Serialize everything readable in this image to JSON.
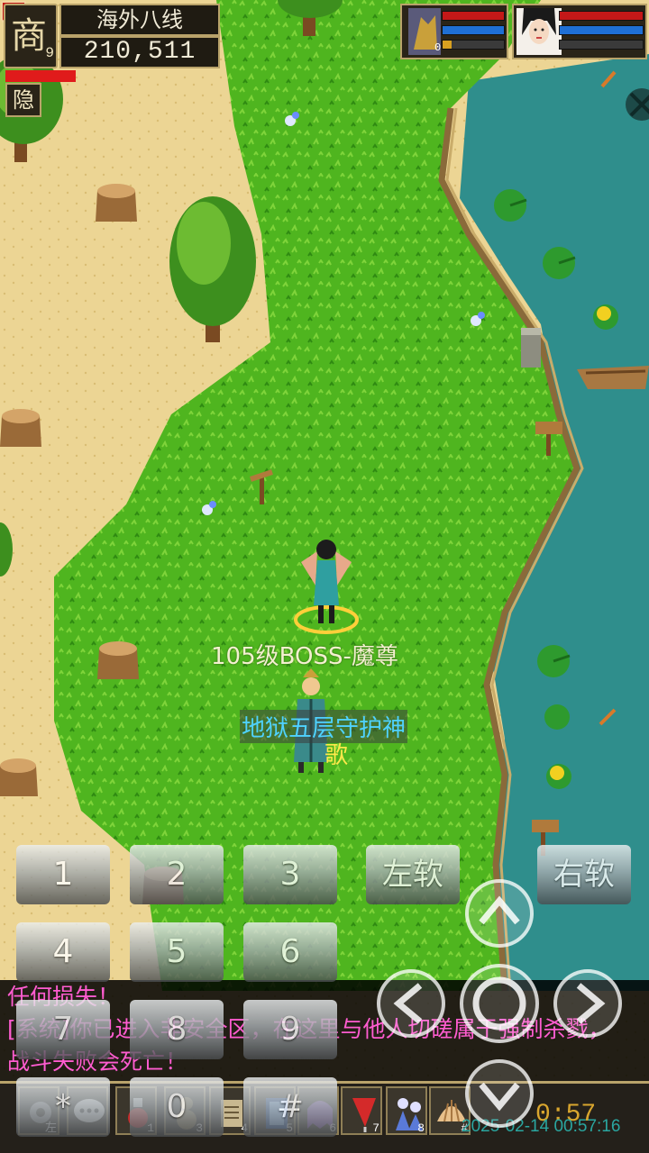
{
  "hud": {
    "avatar_glyph": "商",
    "level": "9",
    "server": "海外八线",
    "money": "210,511",
    "hide_label": "隐",
    "hp_fraction": 0.64,
    "pet": {
      "level": "0",
      "hp": 1.0,
      "mp": 1.0,
      "xp": 0.15
    },
    "player": {
      "hp": 1.0,
      "mp": 1.0,
      "xp": 0.0
    }
  },
  "characters": {
    "boss_name": "105级BOSS-魔尊",
    "npc_title": "地狱五层守护神",
    "npc_name": "歌"
  },
  "keypad": {
    "keys": [
      "1",
      "2",
      "3",
      "4",
      "5",
      "6",
      "7",
      "8",
      "9",
      "*",
      "0",
      "#"
    ],
    "left_soft": "左软",
    "right_soft": "右软"
  },
  "chat": {
    "lines": [
      "任何损失！",
      "[系统]你已进入非安全区，在这里与他人切磋属于强制杀戮，",
      "战斗失败会死亡！"
    ]
  },
  "skillbar": {
    "slots": [
      {
        "icon": "gear-icon",
        "num": "左"
      },
      {
        "icon": "chat-icon",
        "num": ""
      },
      {
        "icon": "potion-icon",
        "num": "1"
      },
      {
        "icon": "gourd-icon",
        "num": "3"
      },
      {
        "icon": "scroll-icon",
        "num": "4"
      },
      {
        "icon": "card-icon",
        "num": "5"
      },
      {
        "icon": "ghost-icon",
        "num": "6"
      },
      {
        "icon": "flag-icon",
        "num": "7"
      },
      {
        "icon": "party-icon",
        "num": "8"
      },
      {
        "icon": "shell-icon",
        "num": "#"
      }
    ],
    "clock": "0:57",
    "timestamp": "2025-02-14 00:57:16"
  }
}
